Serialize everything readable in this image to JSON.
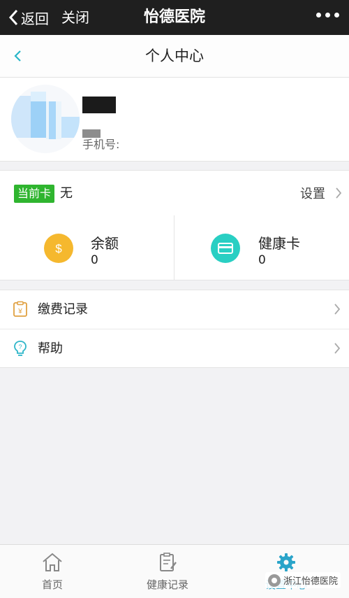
{
  "wechat_bar": {
    "back_label": "返回",
    "close_label": "关闭",
    "title": "怡德医院"
  },
  "page": {
    "title": "个人中心"
  },
  "profile": {
    "phone_label": "手机号:"
  },
  "current_card": {
    "badge": "当前卡",
    "value": "无",
    "settings_label": "设置"
  },
  "stats": [
    {
      "label": "余额",
      "value": "0",
      "icon": "dollar-coin-icon",
      "color": "#f5b82e"
    },
    {
      "label": "健康卡",
      "value": "0",
      "icon": "card-icon",
      "color": "#29cfc3"
    }
  ],
  "menu": [
    {
      "label": "缴费记录",
      "icon": "payment-record-icon"
    },
    {
      "label": "帮助",
      "icon": "help-bulb-icon"
    }
  ],
  "tabbar": [
    {
      "label": "首页",
      "icon": "home-icon"
    },
    {
      "label": "健康记录",
      "icon": "health-record-icon"
    },
    {
      "label": "设置中心",
      "icon": "settings-gear-icon",
      "active": true
    }
  ],
  "watermark": "浙江怡德医院",
  "colors": {
    "accent": "#2aa4c9",
    "badge_green": "#2fb52f",
    "coin_yellow": "#f5b82e",
    "card_teal": "#29cfc3"
  }
}
